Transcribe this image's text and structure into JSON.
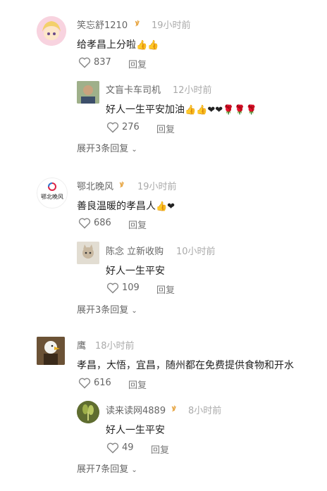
{
  "comments": [
    {
      "user": "笑忘舒1210",
      "verified": true,
      "time": "19小时前",
      "text": "给孝昌上分啦",
      "emoji": "👍👍",
      "likes": "837",
      "reply_label": "回复",
      "reply": {
        "user": "文盲卡车司机",
        "time": "12小时前",
        "text": "好人一生平安加油",
        "emoji": "👍👍❤❤🌹🌹🌹",
        "likes": "276",
        "reply_label": "回复"
      },
      "expand": "展开3条回复"
    },
    {
      "user": "鄂北晚风",
      "verified": true,
      "time": "19小时前",
      "text": "善良温暖的孝昌人",
      "emoji": "👍❤",
      "likes": "686",
      "reply_label": "回复",
      "reply": {
        "user": "陈念 立新收购",
        "time": "10小时前",
        "text": "好人一生平安",
        "emoji": "",
        "likes": "109",
        "reply_label": "回复"
      },
      "expand": "展开3条回复"
    },
    {
      "user": "鹰",
      "verified": false,
      "time": "18小时前",
      "text": "孝昌，大悟，宜昌，随州都在免费提供食物和开水",
      "emoji": "",
      "likes": "616",
      "reply_label": "回复",
      "reply": {
        "user": "读来读网4889",
        "verified": true,
        "time": "8小时前",
        "text": "好人一生平安",
        "emoji": "",
        "likes": "49",
        "reply_label": "回复"
      },
      "expand": "展开7条回复"
    }
  ],
  "logo_text": "鄂北晚风"
}
